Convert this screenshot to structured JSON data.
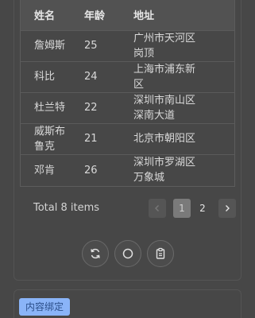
{
  "table": {
    "headers": {
      "name": "姓名",
      "age": "年龄",
      "address": "地址"
    },
    "rows": [
      {
        "name": "詹姆斯",
        "age": "25",
        "address_l1": "广州市天河区",
        "address_l2": "岗顶"
      },
      {
        "name": "科比",
        "age": "24",
        "address_l1": "上海市浦东新",
        "address_l2": "区"
      },
      {
        "name": "杜兰特",
        "age": "22",
        "address_l1": "深圳市南山区",
        "address_l2": "深南大道"
      },
      {
        "name_l1": "威斯布",
        "name_l2": "鲁克",
        "age": "21",
        "address_l1": "北京市朝阳区",
        "address_l2": ""
      },
      {
        "name": "邓肯",
        "age": "26",
        "address_l1": "深圳市罗湖区",
        "address_l2": "万象城"
      }
    ]
  },
  "pagination": {
    "total_text": "Total 8 items",
    "pages": [
      "1",
      "2"
    ],
    "current": "1"
  },
  "actions": [
    {
      "icon": "refresh-icon"
    },
    {
      "icon": "circle-icon"
    },
    {
      "icon": "clipboard-icon"
    }
  ],
  "section2": {
    "tag_label": "内容绑定"
  },
  "colors": {
    "background": "#474747",
    "tag": "#8ab4f8",
    "active_page": "#7a7a7a"
  }
}
